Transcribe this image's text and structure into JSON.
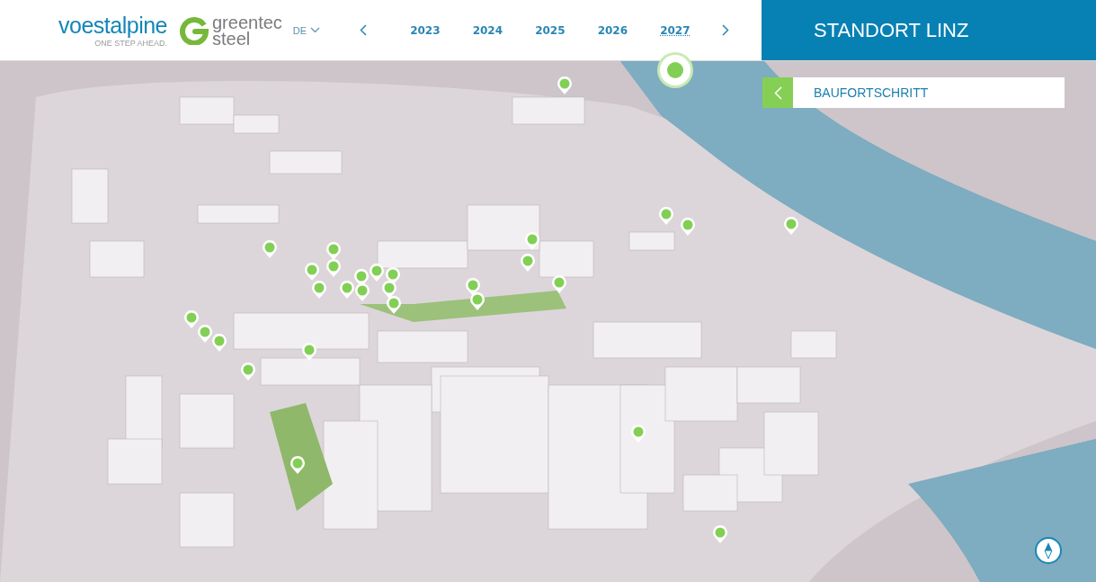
{
  "header": {
    "brand": {
      "name": "voestalpine",
      "tagline": "ONE STEP AHEAD."
    },
    "program_logo": {
      "line_1": "greentec",
      "line_2": "steel"
    },
    "language": {
      "value": "DE"
    },
    "years": [
      {
        "label": "2023",
        "selected": false
      },
      {
        "label": "2024",
        "selected": false
      },
      {
        "label": "2025",
        "selected": false
      },
      {
        "label": "2026",
        "selected": false
      },
      {
        "label": "2027",
        "selected": true
      }
    ],
    "site_title": "STANDORT LINZ"
  },
  "panel": {
    "title": "BAUFORTSCHRITT",
    "expanded": false
  }
}
